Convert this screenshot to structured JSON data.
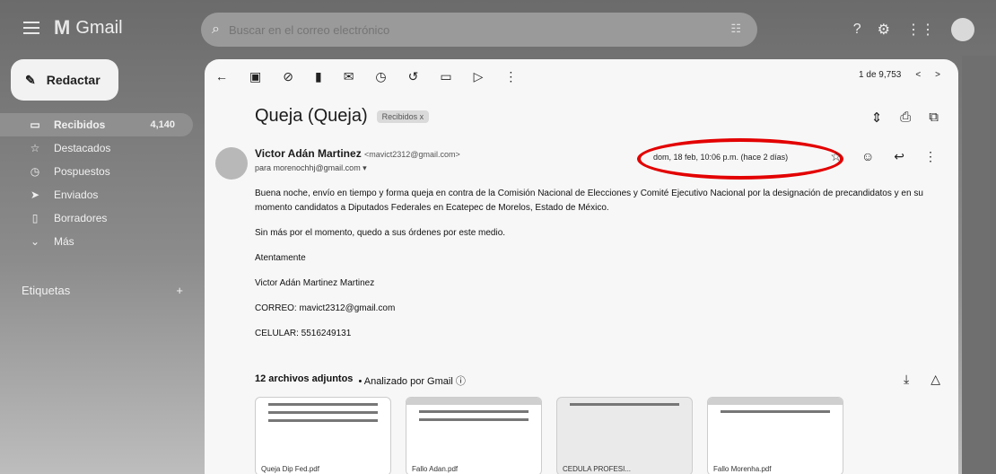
{
  "app": {
    "name": "Gmail"
  },
  "search": {
    "placeholder": "Buscar en el correo electrónico"
  },
  "compose": {
    "label": "Redactar"
  },
  "sidebar": {
    "items": [
      {
        "label": "Recibidos",
        "count": "4,140"
      },
      {
        "label": "Destacados",
        "count": ""
      },
      {
        "label": "Pospuestos",
        "count": ""
      },
      {
        "label": "Enviados",
        "count": ""
      },
      {
        "label": "Borradores",
        "count": ""
      },
      {
        "label": "Más",
        "count": ""
      }
    ],
    "labels_title": "Etiquetas",
    "labels_add": "+"
  },
  "email": {
    "pager": {
      "text": "1 de 9,753",
      "prev": "<",
      "next": ">"
    },
    "subject": "Queja (Queja)",
    "chip": "Recibidos x",
    "sender_name": "Victor Adán Martinez",
    "sender_email": "<mavict2312@gmail.com>",
    "to": "para morenochhj@gmail.com ▾",
    "date": "dom, 18 feb, 10:06 p.m. (hace 2 días)",
    "body": [
      "Buena noche, envío en tiempo y forma queja en contra de la Comisión Nacional de Elecciones y Comité Ejecutivo Nacional por la designación de precandidatos y en su momento candidatos a Diputados Federales en Ecatepec de Morelos, Estado de México.",
      "Sin más por el momento, quedo a sus órdenes por este medio.",
      "Atentamente",
      "Victor Adán Martinez Martinez",
      "CORREO: mavict2312@gmail.com",
      "CELULAR: 5516249131"
    ],
    "attachments": {
      "header": "12 archivos adjuntos",
      "analyzed": "• Analizado por Gmail ⓘ",
      "files": [
        {
          "name": "Queja Dip Fed.pdf"
        },
        {
          "name": "Fallo Adan.pdf"
        },
        {
          "name": "CEDULA PROFESI..."
        },
        {
          "name": "Fallo Morenha.pdf"
        }
      ]
    }
  }
}
